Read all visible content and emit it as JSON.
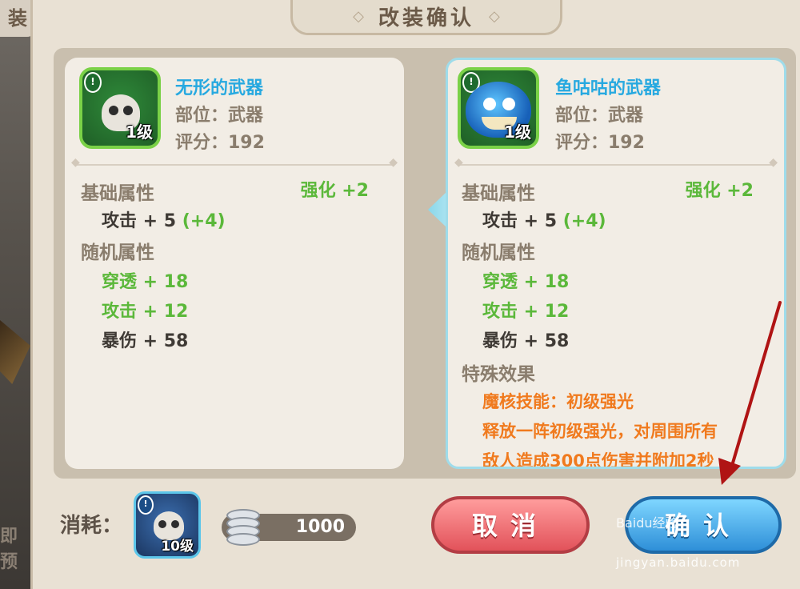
{
  "background": {
    "tab_fragment": "装",
    "bottom_fragment": "即预"
  },
  "dialog": {
    "title": "改装确认"
  },
  "left_card": {
    "item_name": "无形的武器",
    "slot": "部位：武器",
    "score": "评分：192",
    "level": "1级",
    "base_section": "基础属性",
    "enhance": "强化 +2",
    "base_attack": "攻击 + 5",
    "base_bonus": "(+4)",
    "random_section": "随机属性",
    "random_stats": [
      "穿透 + 18",
      "攻击 + 12",
      "暴伤 + 58"
    ]
  },
  "right_card": {
    "item_name": "鱼咕咕的武器",
    "slot": "部位：武器",
    "score": "评分：192",
    "level": "1级",
    "base_section": "基础属性",
    "enhance": "强化 +2",
    "base_attack": "攻击 + 5",
    "base_bonus": "(+4)",
    "random_section": "随机属性",
    "random_stats": [
      "穿透 + 18",
      "攻击 + 12",
      "暴伤 + 58"
    ],
    "special_section": "特殊效果",
    "special_lines": [
      "魔核技能：初级强光",
      "释放一阵初级强光，对周围所有",
      "敌人造成300点伤害并附加2秒"
    ]
  },
  "footer": {
    "cost_label": "消耗：",
    "cost_item_level": "10级",
    "coin_amount": "1000",
    "cancel_label": "取消",
    "confirm_label": "确认"
  },
  "watermark": {
    "logo": "Baidu经验",
    "site": "jingyan.baidu.com"
  },
  "colors": {
    "title_brown": "#6b5a48",
    "name_blue": "#27a9e0",
    "stat_green": "#5bb83a",
    "special_orange": "#f07a1e",
    "cancel_red": "#e2525a",
    "confirm_blue": "#2e8fd8",
    "annotation_arrow": "#b01414"
  }
}
